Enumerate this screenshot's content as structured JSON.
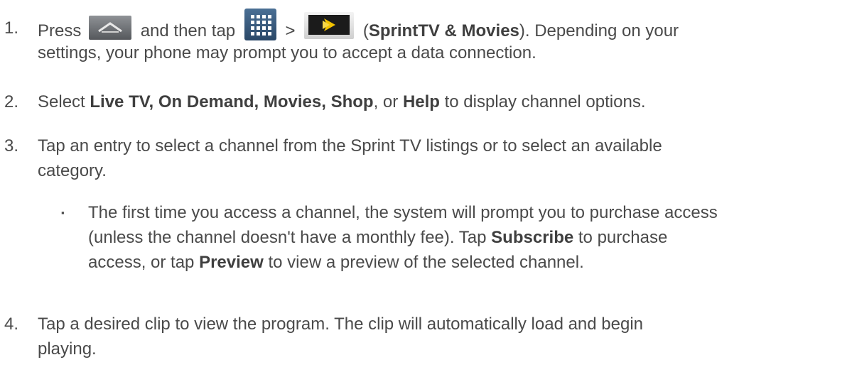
{
  "steps": [
    {
      "num": "1.",
      "line1": {
        "press": "Press",
        "and_then_tap": "and then tap",
        "gt": ">",
        "open_paren": "(",
        "app_name": "SprintTV & Movies",
        "rest": "). Depending on your"
      },
      "line2": "settings, your phone may prompt you to accept a data connection."
    },
    {
      "num": "2.",
      "select": "Select",
      "options": "Live TV, On Demand, Movies, Shop",
      "or": ", or",
      "help": "Help",
      "rest": "to display channel options."
    },
    {
      "num": "3.",
      "line1": "Tap an entry to select a channel from the Sprint TV listings or to select an available",
      "line2": "category.",
      "bullet": {
        "marker": "▪",
        "line1": "The first time you access a channel, the system will prompt you to purchase access",
        "line2_pre": "(unless the channel doesn't have a monthly fee). Tap",
        "subscribe": "Subscribe",
        "line2_post": "to purchase",
        "line3_pre": "access, or tap",
        "preview": "Preview",
        "line3_post": "to view a preview of the selected channel."
      }
    },
    {
      "num": "4.",
      "line1": "Tap a desired clip to view the program. The clip will automatically load and begin",
      "line2": "playing."
    }
  ],
  "icons": {
    "home": "home-key-icon",
    "apps": "apps-grid-icon",
    "sprint": "sprint-tv-icon"
  }
}
